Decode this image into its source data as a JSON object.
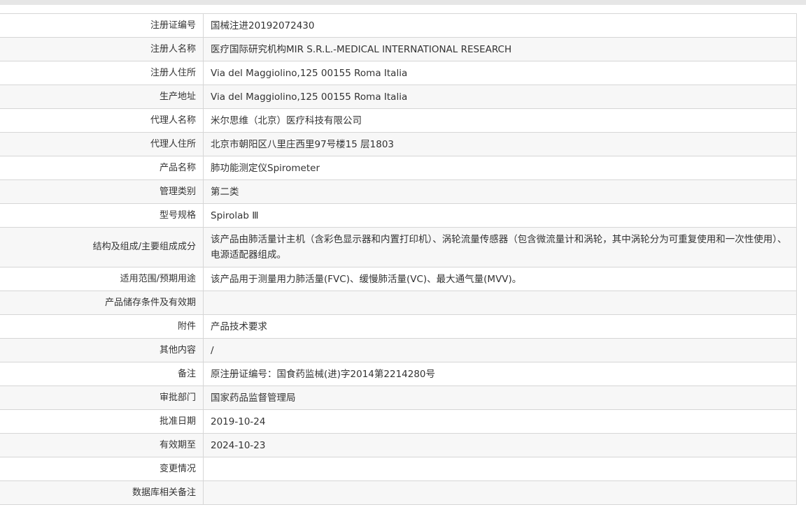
{
  "rows": [
    {
      "label": "注册证编号",
      "value": "国械注进20192072430"
    },
    {
      "label": "注册人名称",
      "value": "医疗国际研究机构MIR S.R.L.-MEDICAL INTERNATIONAL RESEARCH"
    },
    {
      "label": "注册人住所",
      "value": "Via del Maggiolino,125 00155 Roma Italia"
    },
    {
      "label": "生产地址",
      "value": "Via del Maggiolino,125 00155 Roma Italia"
    },
    {
      "label": "代理人名称",
      "value": "米尔思维（北京）医疗科技有限公司"
    },
    {
      "label": "代理人住所",
      "value": "北京市朝阳区八里庄西里97号楼15 层1803"
    },
    {
      "label": "产品名称",
      "value": "肺功能测定仪Spirometer"
    },
    {
      "label": "管理类别",
      "value": "第二类"
    },
    {
      "label": "型号规格",
      "value": "Spirolab Ⅲ"
    },
    {
      "label": "结构及组成/主要组成成分",
      "value": "该产品由肺活量计主机（含彩色显示器和内置打印机）、涡轮流量传感器（包含微流量计和涡轮，其中涡轮分为可重复使用和一次性使用）、电源适配器组成。"
    },
    {
      "label": "适用范围/预期用途",
      "value": "该产品用于测量用力肺活量(FVC)、缓慢肺活量(VC)、最大通气量(MVV)。"
    },
    {
      "label": "产品储存条件及有效期",
      "value": ""
    },
    {
      "label": "附件",
      "value": "产品技术要求"
    },
    {
      "label": "其他内容",
      "value": "/"
    },
    {
      "label": "备注",
      "value": "原注册证编号：国食药监械(进)字2014第2214280号"
    },
    {
      "label": "审批部门",
      "value": "国家药品监督管理局"
    },
    {
      "label": "批准日期",
      "value": "2019-10-24"
    },
    {
      "label": "有效期至",
      "value": "2024-10-23"
    },
    {
      "label": "变更情况",
      "value": ""
    },
    {
      "label": "数据库相关备注",
      "value": ""
    }
  ]
}
